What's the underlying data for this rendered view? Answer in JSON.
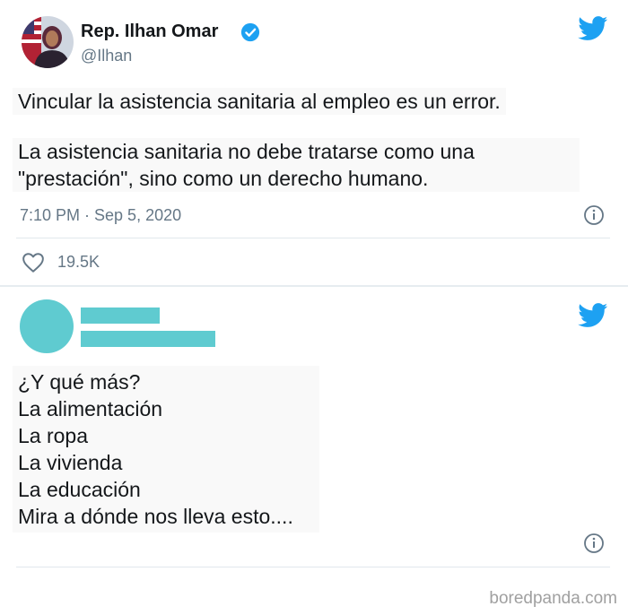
{
  "tweet1": {
    "display_name": "Rep. Ilhan Omar",
    "handle": "@Ilhan",
    "text_line1": "Vincular la asistencia sanitaria al empleo es un error.",
    "text_para2": "La asistencia sanitaria no debe tratarse como una\n\"prestación\", sino como un derecho humano.",
    "timestamp": "7:10 PM · Sep 5, 2020",
    "likes": "19.5K"
  },
  "tweet2": {
    "lines": [
      "¿Y qué más?",
      "La alimentación",
      "La ropa",
      "La vivienda",
      "La educación",
      "Mira a dónde nos lleva esto...."
    ]
  },
  "watermark": "boredpanda.com",
  "colors": {
    "twitter_blue": "#1da1f2",
    "redaction": "#5fcbd0",
    "secondary_text": "#657786"
  },
  "icons": [
    "twitter-bird-icon",
    "verified-badge-icon",
    "info-icon",
    "heart-icon"
  ]
}
